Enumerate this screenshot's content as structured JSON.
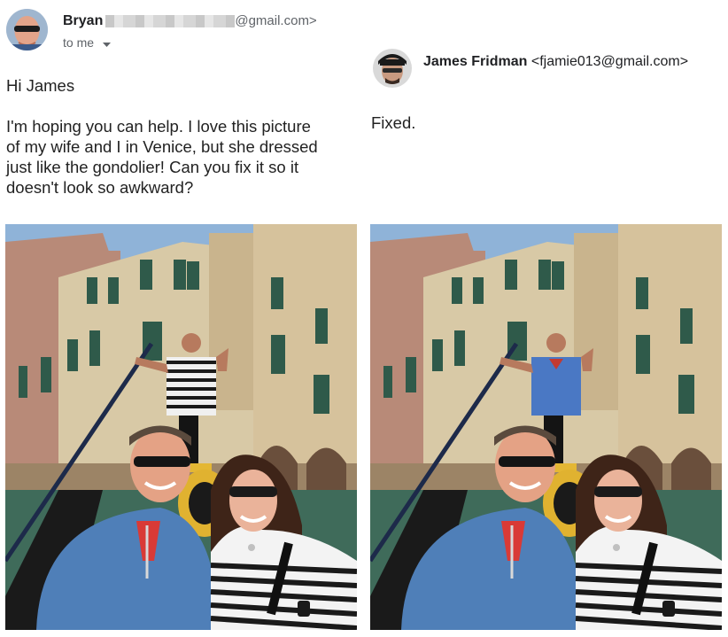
{
  "left_email": {
    "sender_name": "Bryan",
    "sender_email_suffix": "@gmail.com>",
    "recipient_label": "to me",
    "greeting": "Hi James",
    "body_lines": [
      "I'm hoping you can help. I love this picture",
      "of my wife and I in Venice, but she dressed",
      "just like the gondolier! Can you fix it so it",
      "doesn't look so awkward?"
    ]
  },
  "right_email": {
    "sender_name": "James Fridman",
    "sender_email": "<fjamie013@gmail.com>",
    "reply": "Fixed."
  },
  "photos": {
    "gondolier_shirt_original": "striped",
    "gondolier_shirt_edited": "blue"
  },
  "colors": {
    "sky": "#8fb3d8",
    "building_cream": "#d8c9a6",
    "building_pink": "#b88a78",
    "shutter_green": "#2f5a4a",
    "water": "#3f6b5a",
    "jacket_blue": "#4f7fb8",
    "edited_shirt_blue": "#4a78c4"
  },
  "icons": [
    "avatar-bryan",
    "avatar-james",
    "chevron-down-icon"
  ]
}
